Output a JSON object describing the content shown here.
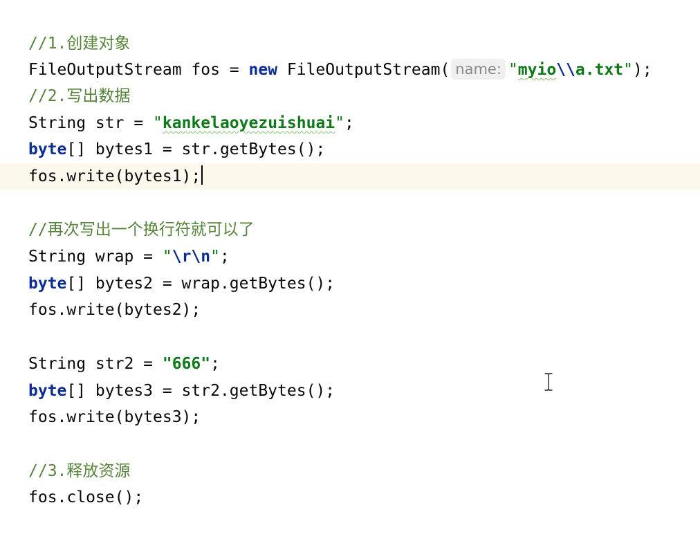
{
  "code": {
    "comment_create": "//1.创建对象",
    "fos_decl_prefix": "FileOutputStream fos = ",
    "kw_new": "new",
    "fos_ctor": " FileOutputStream(",
    "param_hint": "name:",
    "path_open_quote": "\"",
    "path_myio": "myio",
    "path_escape": "\\\\",
    "path_rest": "a.txt",
    "path_close_quote": "\"",
    "fos_decl_suffix": ");",
    "comment_write": "//2.写出数据",
    "str_decl_prefix": "String str = ",
    "str_value_open": "\"",
    "str_value": "kankelaoyezuishuai",
    "str_value_close": "\"",
    "str_decl_suffix": ";",
    "kw_byte1": "byte",
    "bytes1_decl": "[] bytes1 = str.getBytes();",
    "write1": "fos.write(bytes1);",
    "comment_newline": "//再次写出一个换行符就可以了",
    "wrap_decl_prefix": "String wrap = ",
    "wrap_open_quote": "\"",
    "wrap_escape": "\\r\\n",
    "wrap_close_quote": "\"",
    "wrap_decl_suffix": ";",
    "kw_byte2": "byte",
    "bytes2_decl": "[] bytes2 = wrap.getBytes();",
    "write2": "fos.write(bytes2);",
    "str2_decl_prefix": "String str2 = ",
    "str2_value": "\"666\"",
    "str2_decl_suffix": ";",
    "kw_byte3": "byte",
    "bytes3_decl": "[] bytes3 = str2.getBytes();",
    "write3": "fos.write(bytes3);",
    "comment_release": "//3.释放资源",
    "close_call": "fos.close();"
  },
  "colors": {
    "comment": "#56833a",
    "keyword": "#0b2d93",
    "string": "#107a1a",
    "current_line": "#fcf9ec",
    "hint_bg": "#f0f0f0"
  },
  "icons": {
    "mouse_cursor": "text-ibeam-cursor-icon"
  }
}
